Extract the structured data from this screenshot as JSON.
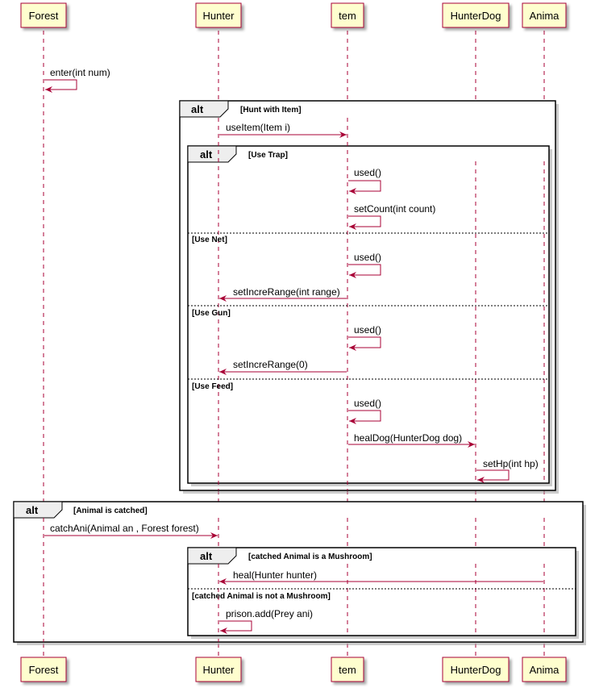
{
  "participants": [
    {
      "id": "forest",
      "label": "Forest"
    },
    {
      "id": "hunter",
      "label": "Hunter"
    },
    {
      "id": "item",
      "label": "tem"
    },
    {
      "id": "hunterdog",
      "label": "HunterDog"
    },
    {
      "id": "animal",
      "label": "Anima"
    }
  ],
  "alt_keyword": "alt",
  "groups": {
    "hunt": {
      "guard": "[Hunt with Item]",
      "use_item": "useItem(Item i)",
      "inner": {
        "guard_trap": "[Use Trap]",
        "trap_used": "used()",
        "trap_setcount": "setCount(int count)",
        "guard_net": "[Use Net]",
        "net_used": "used()",
        "net_setincre": "setIncreRange(int range)",
        "guard_gun": "[Use Gun]",
        "gun_used": "used()",
        "gun_setincre": "setIncreRange(0)",
        "guard_feed": "[Use Feed]",
        "feed_used": "used()",
        "feed_heal": "healDog(HunterDog dog)",
        "feed_sethp": "setHp(int hp)"
      }
    },
    "catch": {
      "guard": "[Animal is catched]",
      "catch_msg": "catchAni(Animal an , Forest forest)",
      "inner": {
        "guard_mush": "[catched Animal is a Mushroom]",
        "heal": "heal(Hunter hunter)",
        "guard_not": "[catched Animal is not a Mushroom]",
        "prison": "prison.add(Prey ani)"
      }
    }
  },
  "enter_msg": "enter(int num)"
}
